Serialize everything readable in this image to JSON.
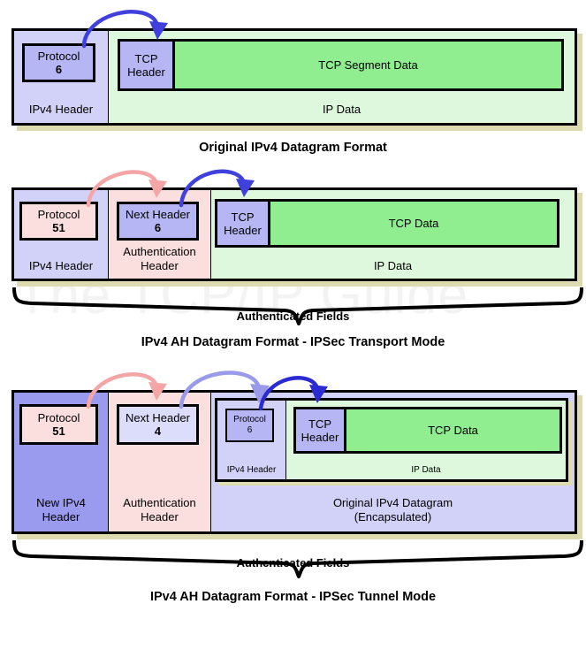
{
  "watermark": "The TCP/IP Guide",
  "colors": {
    "ipv4_header_fill": "#d2d2f8",
    "new_ipv4_header_fill": "#9a9aee",
    "ip_data_fill": "#ddf8dd",
    "tcp_data_fill": "#90ee90",
    "tcp_header_fill": "#b6b6f4",
    "auth_header_fill": "#fbdede",
    "protocol_box_blue": "#b6b6f4",
    "protocol_box_pink": "#fbdede",
    "next_header_box_blue": "#b6b6f4",
    "next_header_box_lavender": "#dcdcfb",
    "arrow_blue": "#4040dd",
    "arrow_light_blue": "#9a9aea",
    "arrow_pink": "#f4a6a6",
    "shadow": "#dedbb0",
    "outline": "#000000",
    "watermark_gray": "#f3f3f3"
  },
  "diagram1": {
    "caption": "Original IPv4 Datagram Format",
    "segments": [
      {
        "label": "IPv4 Header"
      },
      {
        "label": "IP Data"
      }
    ],
    "protocol_field": {
      "name": "Protocol",
      "value": "6"
    },
    "tcp_header_label": "TCP\nHeader",
    "tcp_header_line1": "TCP",
    "tcp_header_line2": "Header",
    "tcp_data_label": "TCP Segment Data"
  },
  "diagram2": {
    "caption": "IPv4 AH Datagram Format - IPSec Transport Mode",
    "authenticated_label": "Authenticated Fields",
    "segments": [
      {
        "label": "IPv4 Header"
      },
      {
        "label_line1": "Authentication",
        "label_line2": "Header"
      },
      {
        "label": "IP Data"
      }
    ],
    "protocol_field": {
      "name": "Protocol",
      "value": "51"
    },
    "next_header_field": {
      "name": "Next Header",
      "value": "6"
    },
    "tcp_header_line1": "TCP",
    "tcp_header_line2": "Header",
    "tcp_data_label": "TCP Data"
  },
  "diagram3": {
    "caption": "IPv4 AH Datagram Format - IPSec Tunnel Mode",
    "authenticated_label": "Authenticated Fields",
    "segments": [
      {
        "label_line1": "New IPv4",
        "label_line2": "Header"
      },
      {
        "label_line1": "Authentication",
        "label_line2": "Header"
      },
      {
        "label_line1": "Original IPv4 Datagram",
        "label_line2": "(Encapsulated)"
      }
    ],
    "protocol_field": {
      "name": "Protocol",
      "value": "51"
    },
    "next_header_field": {
      "name": "Next Header",
      "value": "4"
    },
    "inner": {
      "protocol_field": {
        "name": "Protocol",
        "value": "6"
      },
      "ipv4_header_label": "IPv4 Header",
      "ip_data_label": "IP Data",
      "tcp_header_line1": "TCP",
      "tcp_header_line2": "Header",
      "tcp_data_label": "TCP Data"
    }
  }
}
